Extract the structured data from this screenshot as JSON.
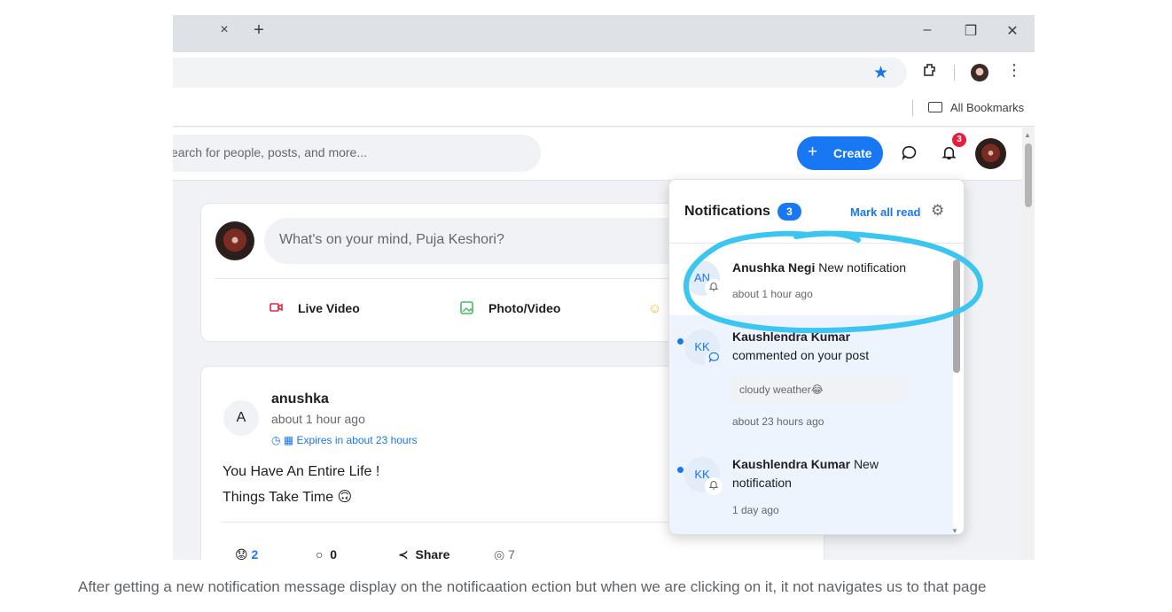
{
  "browser": {
    "tab_close_icon": "×",
    "new_tab_icon": "+",
    "minimize_icon": "–",
    "restore_icon": "❐",
    "close_icon": "✕",
    "star_icon": "★",
    "bookmarks_label": "All Bookmarks"
  },
  "header": {
    "search_placeholder": "earch for people, posts, and more...",
    "create_label": "Create",
    "create_icon": "+",
    "notification_badge": "3"
  },
  "composer": {
    "placeholder": "What's on your mind, Puja Keshori?",
    "actions": [
      {
        "label": "Live Video",
        "color": "#e42645"
      },
      {
        "label": "Photo/Video",
        "color": "#45bd62"
      }
    ]
  },
  "post": {
    "avatar_letter": "A",
    "author": "anushka",
    "time": "about 1 hour ago",
    "expires": "Expires in about 23 hours",
    "line1": "You Have An Entire Life !",
    "line2": "Things Take Time 🙃",
    "reactions": "2",
    "comments": "0",
    "share_label": "Share",
    "views": "7"
  },
  "notifications": {
    "title": "Notifications",
    "count": "3",
    "mark_all_label": "Mark all read",
    "items": [
      {
        "initials": "AN",
        "name": "Anushka Negi",
        "text": "New notification",
        "time": "about 1 hour ago",
        "unread": false,
        "type_icon": "bell-icon"
      },
      {
        "initials": "KK",
        "name": "Kaushlendra Kumar",
        "text": "commented on your post",
        "preview": "cloudy weather😂",
        "time": "about 23 hours ago",
        "unread": true,
        "type_icon": "comment-icon"
      },
      {
        "initials": "KK",
        "name": "Kaushlendra Kumar",
        "text": "New notification",
        "time": "1 day ago",
        "unread": true,
        "type_icon": "bell-icon"
      }
    ]
  },
  "caption": "After getting a new notification message display on the notificaation ection but when we are clicking on it, it not navigates us to that page",
  "colors": {
    "accent": "#1877f2",
    "annotation": "#3ac6f0",
    "unread_bg": "#eef4fd"
  }
}
